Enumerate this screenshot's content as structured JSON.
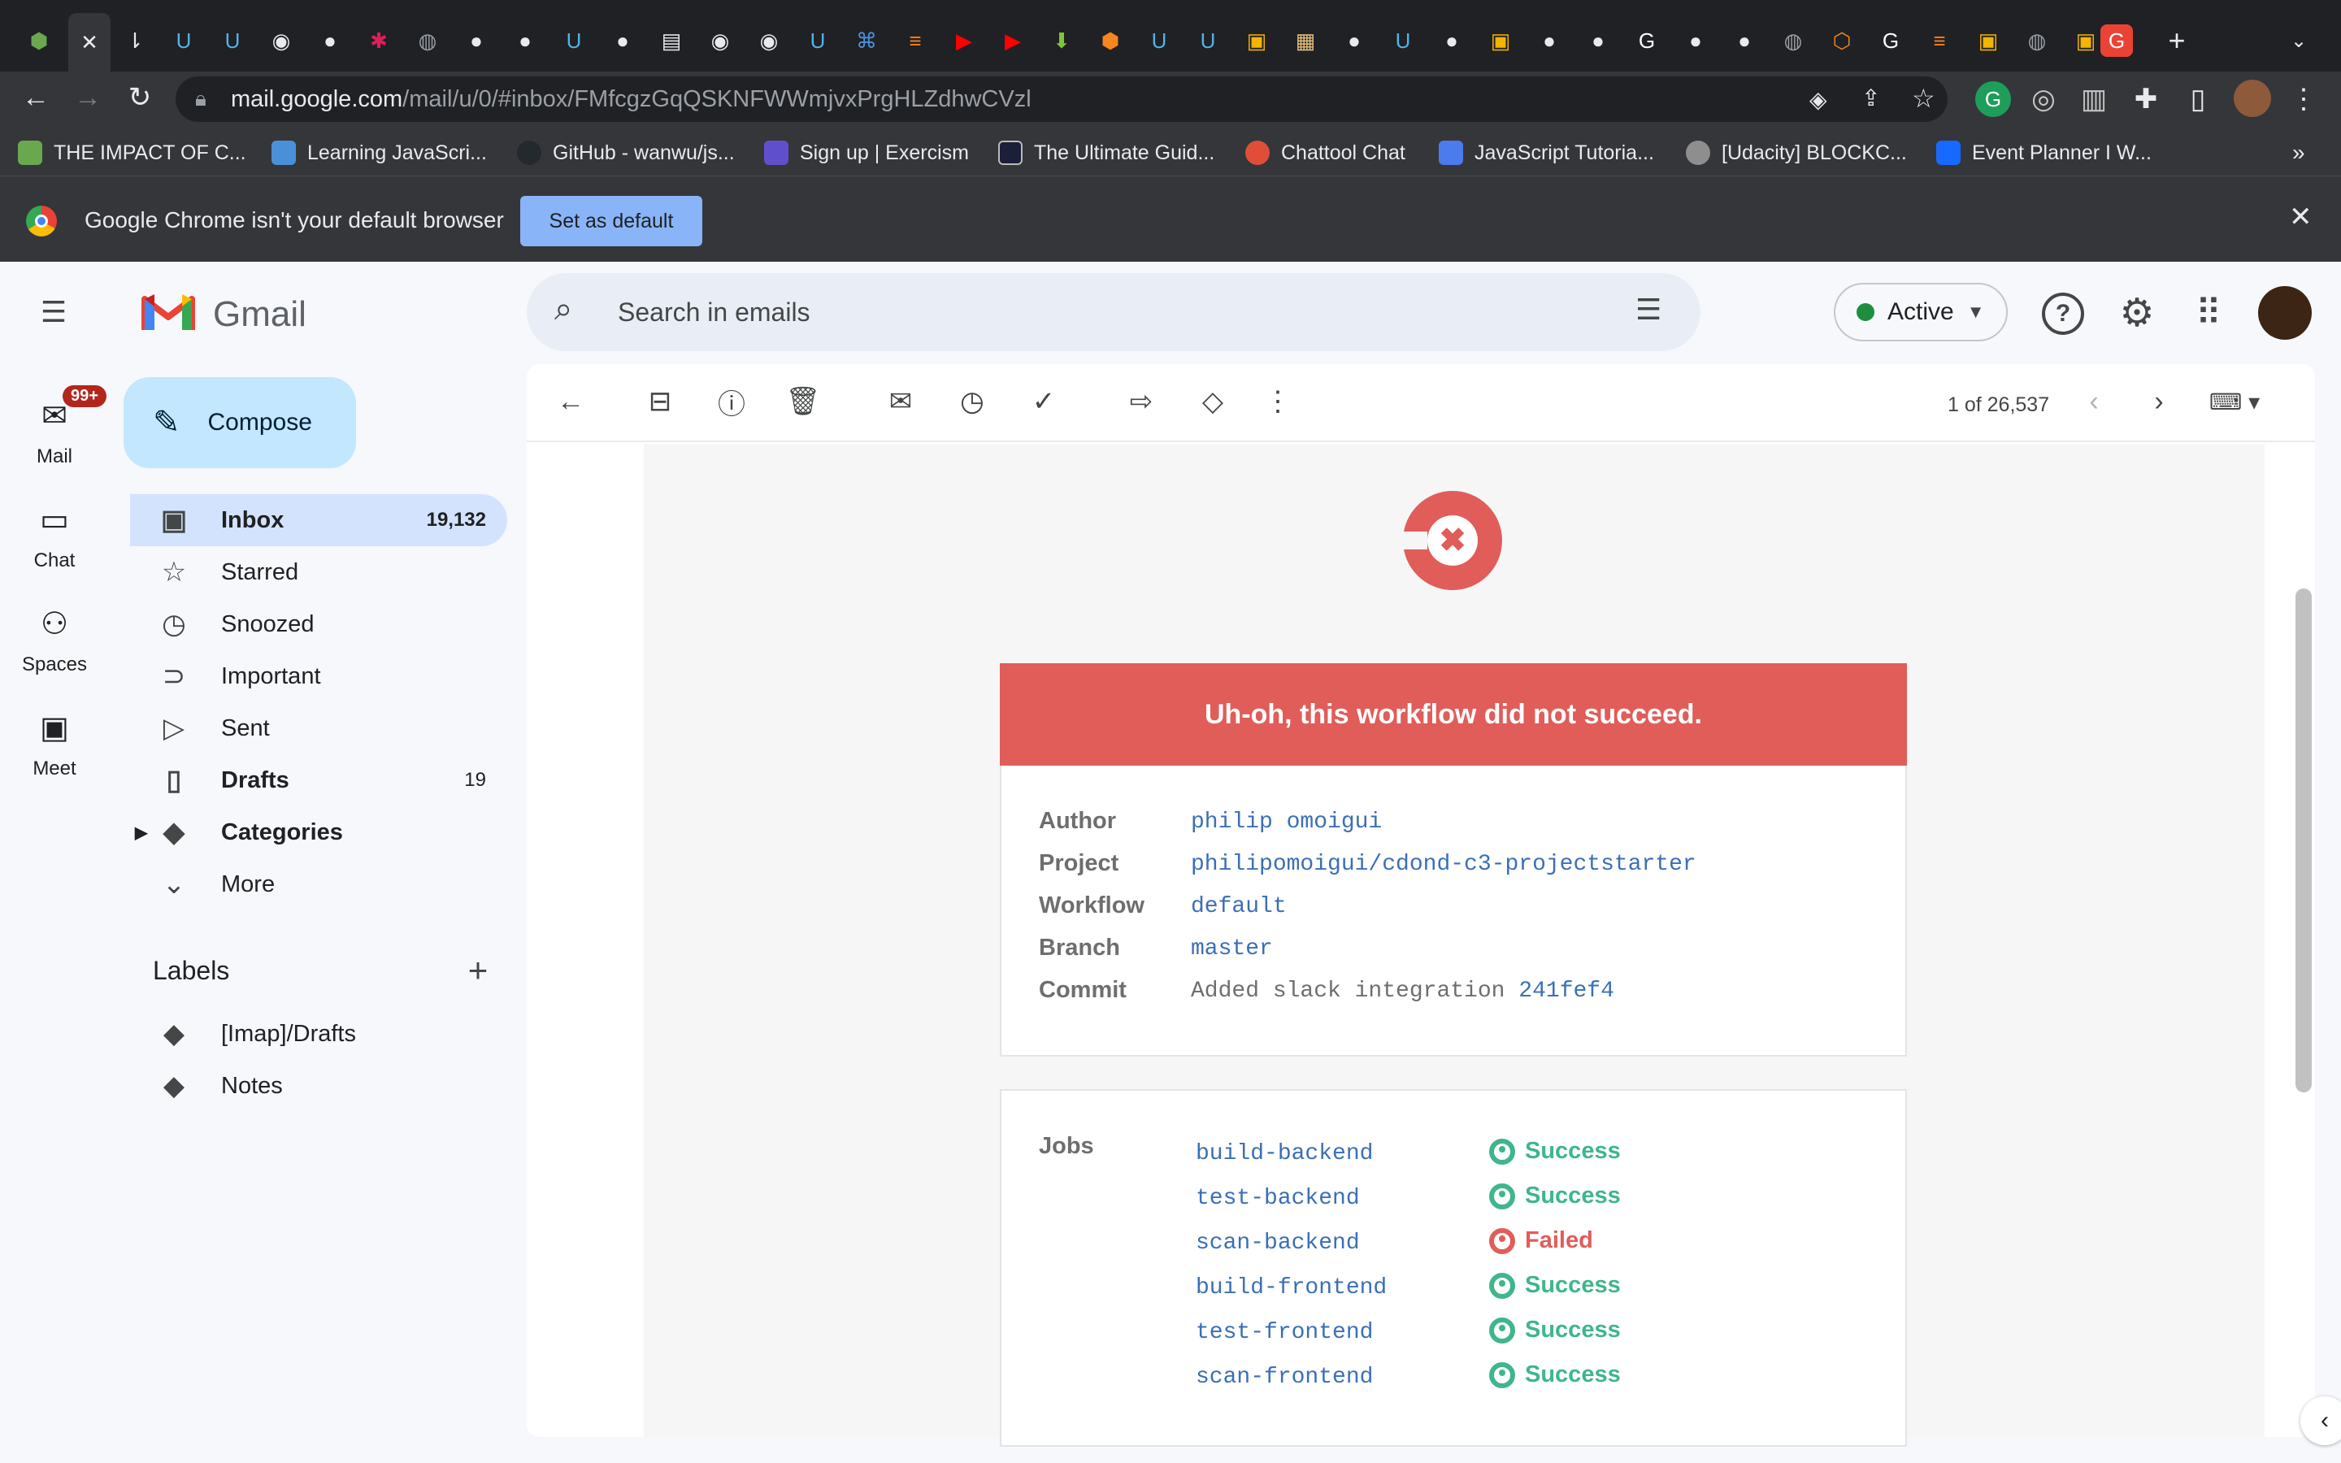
{
  "browser": {
    "url_host": "mail.google.com",
    "url_path": "/mail/u/0/#inbox/FMfcgzGqQSKNFWWmjvxPrgHLZdhwCVzl",
    "bookmarks": [
      {
        "label": "THE IMPACT OF C...",
        "color": "#6aa84f"
      },
      {
        "label": "Learning JavaScri...",
        "color": "#4a90d9"
      },
      {
        "label": "GitHub - wanwu/js...",
        "color": "#24292e"
      },
      {
        "label": "Sign up | Exercism",
        "color": "#604fcd"
      },
      {
        "label": "The Ultimate Guid...",
        "color": "#1b1f3a"
      },
      {
        "label": "Chattool Chat",
        "color": "#e04e39"
      },
      {
        "label": "JavaScript Tutoria...",
        "color": "#4b7bec"
      },
      {
        "label": "[Udacity] BLOCKC...",
        "color": "#8e8e8e"
      },
      {
        "label": "Event Planner I W...",
        "color": "#1769ff"
      }
    ],
    "bookmarks_overflow": "»",
    "infobar_text": "Google Chrome isn't your default browser",
    "infobar_button": "Set as default",
    "new_tab": "+",
    "close_tab": "✕"
  },
  "gmail": {
    "logo_text": "Gmail",
    "search_placeholder": "Search in emails",
    "status": "Active",
    "compose": "Compose",
    "rail": [
      {
        "label": "Mail",
        "badge": "99+"
      },
      {
        "label": "Chat"
      },
      {
        "label": "Spaces"
      },
      {
        "label": "Meet"
      }
    ],
    "nav": [
      {
        "label": "Inbox",
        "count": "19,132"
      },
      {
        "label": "Starred",
        "count": ""
      },
      {
        "label": "Snoozed",
        "count": ""
      },
      {
        "label": "Important",
        "count": ""
      },
      {
        "label": "Sent",
        "count": ""
      },
      {
        "label": "Drafts",
        "count": "19"
      },
      {
        "label": "Categories",
        "count": ""
      },
      {
        "label": "More",
        "count": ""
      }
    ],
    "labels_title": "Labels",
    "labels": [
      "[Imap]/Drafts",
      "Notes"
    ],
    "pagination": "1 of 26,537"
  },
  "email": {
    "banner": "Uh-oh, this workflow did not succeed.",
    "meta": [
      {
        "label": "Author",
        "value": "philip omoigui"
      },
      {
        "label": "Project",
        "value": "philipomoigui/cdond-c3-projectstarter"
      },
      {
        "label": "Workflow",
        "value": "default"
      },
      {
        "label": "Branch",
        "value": "master"
      },
      {
        "label": "Commit",
        "value": "Added slack integration",
        "hash": "241fef4"
      }
    ],
    "jobs_label": "Jobs",
    "jobs": [
      {
        "name": "build-backend",
        "status": "Success"
      },
      {
        "name": "test-backend",
        "status": "Success"
      },
      {
        "name": "scan-backend",
        "status": "Failed"
      },
      {
        "name": "build-frontend",
        "status": "Success"
      },
      {
        "name": "test-frontend",
        "status": "Success"
      },
      {
        "name": "scan-frontend",
        "status": "Success"
      }
    ]
  },
  "colors": {
    "fail": "#e05d5a",
    "success": "#3fb68b",
    "link": "#3b6fb6",
    "compose_bg": "#c2e7ff",
    "inbox_bg": "#d3e3fd"
  }
}
